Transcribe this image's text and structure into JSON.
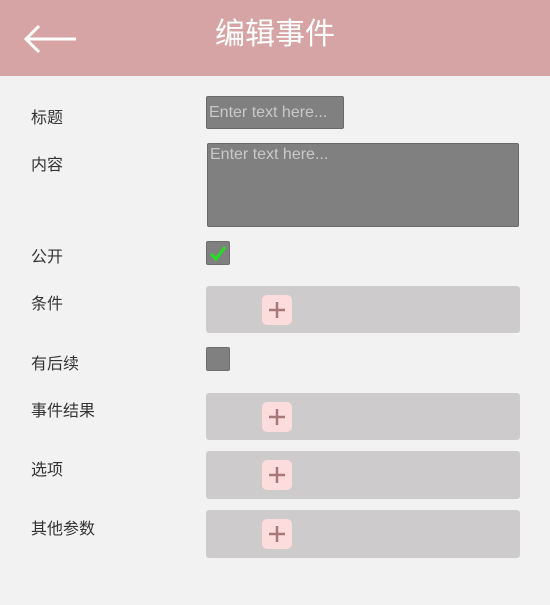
{
  "header": {
    "title": "编辑事件",
    "back_icon": "arrow-left-icon"
  },
  "form": {
    "title_label": "标题",
    "title_placeholder": "Enter text here...",
    "content_label": "内容",
    "content_placeholder": "Enter text here...",
    "public_label": "公开",
    "public_checked": true,
    "condition_label": "条件",
    "has_followup_label": "有后续",
    "has_followup_checked": false,
    "result_label": "事件结果",
    "options_label": "选项",
    "other_params_label": "其他参数"
  },
  "colors": {
    "header_bg": "#d6a4a4",
    "input_bg": "#808080",
    "panel_bg": "#cdcbcb",
    "add_button_bg": "#fcdcdc",
    "add_icon_color": "#a87878",
    "check_color": "#22e022"
  },
  "icons": {
    "add": "plus-icon",
    "check": "checkmark-icon"
  }
}
